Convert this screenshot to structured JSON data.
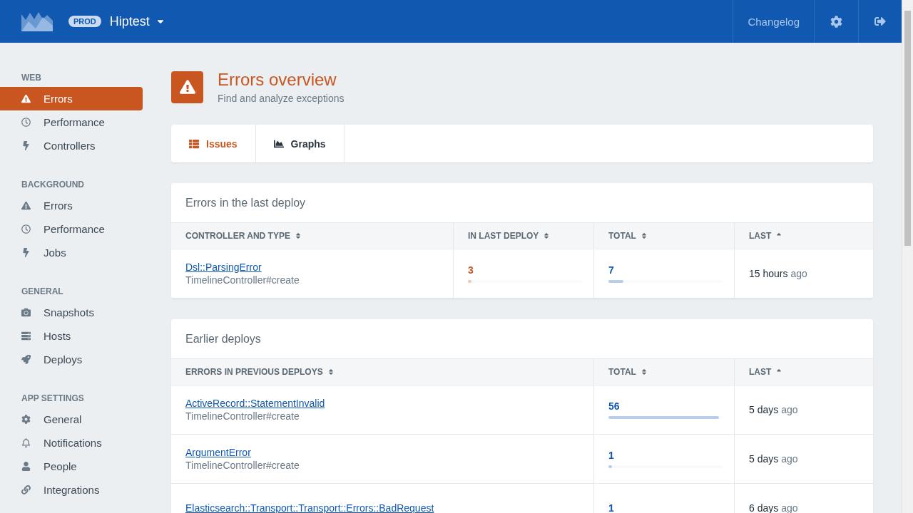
{
  "header": {
    "env_badge": "PROD",
    "app_name": "Hiptest",
    "links": [
      {
        "kind": "text",
        "label": "Changelog"
      },
      {
        "kind": "settings"
      },
      {
        "kind": "logout"
      }
    ]
  },
  "sidebar": {
    "sections": [
      {
        "title": "WEB",
        "items": [
          {
            "label": "Errors",
            "selected": true
          },
          {
            "label": "Performance",
            "selected": false
          },
          {
            "label": "Controllers",
            "selected": false
          }
        ]
      },
      {
        "title": "BACKGROUND",
        "items": [
          {
            "label": "Errors",
            "selected": false
          },
          {
            "label": "Performance",
            "selected": false
          },
          {
            "label": "Jobs",
            "selected": false
          }
        ]
      },
      {
        "title": "GENERAL",
        "items": [
          {
            "label": "Snapshots",
            "selected": false
          },
          {
            "label": "Hosts",
            "selected": false
          },
          {
            "label": "Deploys",
            "selected": false
          }
        ]
      },
      {
        "title": "APP SETTINGS",
        "items": [
          {
            "label": "General",
            "selected": false
          },
          {
            "label": "Notifications",
            "selected": false
          },
          {
            "label": "People",
            "selected": false
          },
          {
            "label": "Integrations",
            "selected": false
          }
        ]
      }
    ]
  },
  "page": {
    "title": "Errors overview",
    "subtitle": "Find and analyze exceptions"
  },
  "tabs": [
    {
      "label": "Issues",
      "selected": true
    },
    {
      "label": "Graphs",
      "selected": false
    }
  ],
  "panels": [
    {
      "title": "Errors in the last deploy",
      "columns": [
        {
          "label": "CONTROLLER AND TYPE",
          "sorted": false
        },
        {
          "label": "IN LAST DEPLOY",
          "sorted": false
        },
        {
          "label": "TOTAL",
          "sorted": false
        },
        {
          "label": "LAST",
          "sorted": true
        }
      ],
      "rows": [
        {
          "error": "Dsl::ParsingError",
          "controller": "TimelineController#create",
          "in_last_deploy": {
            "count": "3",
            "level": 0.03
          },
          "total": {
            "count": "7",
            "level": 0.13
          },
          "last": "15 hours",
          "last_suffix": "ago"
        }
      ]
    },
    {
      "title": "Earlier deploys",
      "columns": [
        {
          "label": "ERRORS IN PREVIOUS DEPLOYS",
          "sorted": false
        },
        {
          "label": "TOTAL",
          "sorted": false
        },
        {
          "label": "LAST",
          "sorted": true
        }
      ],
      "rows": [
        {
          "error": "ActiveRecord::StatementInvalid",
          "controller": "TimelineController#create",
          "total": {
            "count": "56",
            "level": 0.97
          },
          "last": "5 days",
          "last_suffix": "ago"
        },
        {
          "error": "ArgumentError",
          "controller": "TimelineController#create",
          "total": {
            "count": "1",
            "level": 0.03
          },
          "last": "5 days",
          "last_suffix": "ago"
        },
        {
          "error": "Elasticsearch::Transport::Transport::Errors::BadRequest",
          "total": {
            "count": "1"
          },
          "last": "6 days",
          "last_suffix": "ago"
        }
      ]
    }
  ]
}
